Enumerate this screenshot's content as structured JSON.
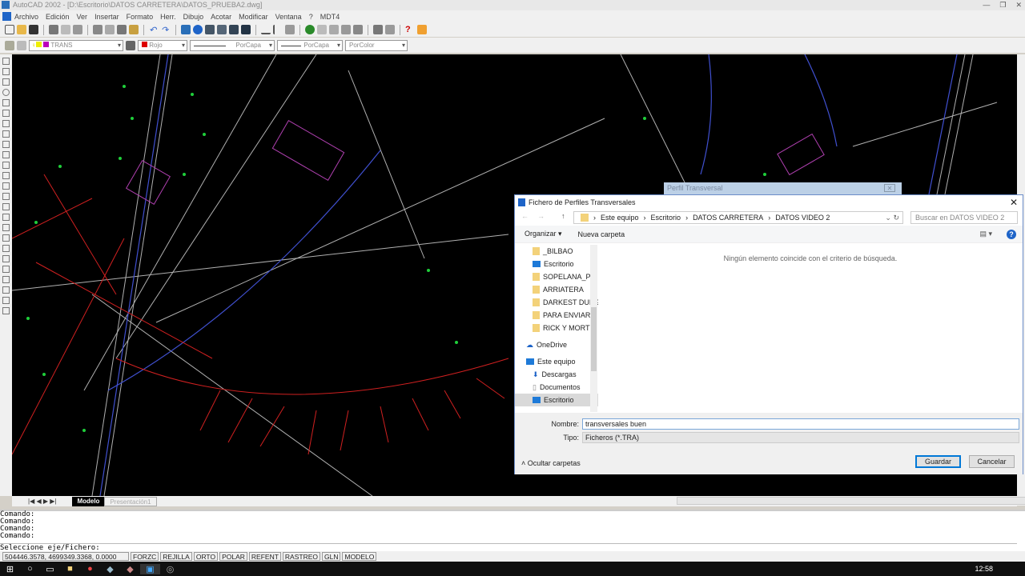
{
  "window": {
    "title": "AutoCAD 2002 - [D:\\Escritorio\\DATOS CARRETERA\\DATOS_PRUEBA2.dwg]"
  },
  "menu": [
    "Archivo",
    "Edición",
    "Ver",
    "Insertar",
    "Formato",
    "Herr.",
    "Dibujo",
    "Acotar",
    "Modificar",
    "Ventana",
    "?",
    "MDT4"
  ],
  "properties": {
    "layer": "TRANS",
    "color": "Rojo",
    "linetype": "PorCapa",
    "lineweight": "PorCapa",
    "plotstyle": "PorColor"
  },
  "tabs": {
    "model": "Modelo",
    "layout": "Presentación1"
  },
  "command": {
    "history": [
      "Comando:",
      "Comando:",
      "Comando:",
      "Comando:"
    ],
    "prompt": "Seleccione eje/Fichero:"
  },
  "status": {
    "coords": "504446.3578, 4699349.3368, 0.0000",
    "toggles": [
      "FORZC",
      "REJILLA",
      "ORTO",
      "POLAR",
      "REFENT",
      "RASTREO",
      "GLN",
      "MODELO"
    ]
  },
  "taskbar": {
    "time": "12:58"
  },
  "behind_window": {
    "title": "Perfil Transversal"
  },
  "dialog": {
    "title": "Fichero de Perfiles Transversales",
    "breadcrumb": [
      "Este equipo",
      "Escritorio",
      "DATOS CARRETERA",
      "DATOS VIDEO 2"
    ],
    "search_placeholder": "Buscar en DATOS VIDEO 2",
    "organize": "Organizar ▾",
    "new_folder": "Nueva carpeta",
    "nav": {
      "quick": [
        "_BILBAO",
        "Escritorio",
        "SOPELANA_P",
        "ARRIATERA",
        "DARKEST DUNG",
        "PARA ENVIAR",
        "RICK Y MORTY"
      ],
      "onedrive": "OneDrive",
      "thispc": "Este equipo",
      "pc_items": [
        "Descargas",
        "Documentos",
        "Escritorio"
      ]
    },
    "empty_message": "Ningún elemento coincide con el criterio de búsqueda.",
    "name_label": "Nombre:",
    "name_value": "transversales buen",
    "type_label": "Tipo:",
    "type_value": "Ficheros (*.TRA)",
    "hide_folders": "Ocultar carpetas",
    "save": "Guardar",
    "cancel": "Cancelar"
  }
}
